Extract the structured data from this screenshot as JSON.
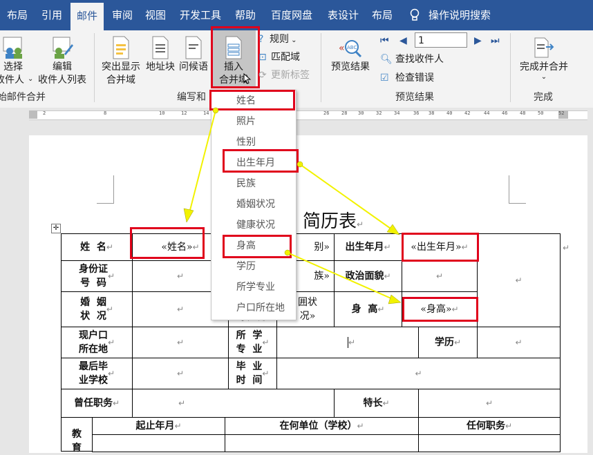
{
  "tabs": [
    "布局",
    "引用",
    "邮件",
    "审阅",
    "视图",
    "开发工具",
    "帮助",
    "百度网盘",
    "表设计",
    "布局"
  ],
  "tell_me": "操作说明搜索",
  "ribbon": {
    "select_recipients": [
      "选择",
      "收件人"
    ],
    "edit_recipients": [
      "编辑",
      "收件人列表"
    ],
    "start_group": "始邮件合并",
    "highlight": [
      "突出显示",
      "合并域"
    ],
    "address_block": "地址块",
    "greeting": "问候语",
    "insert_field": [
      "插入",
      "合并域"
    ],
    "rules": "规则",
    "match_fields": "匹配域",
    "update_labels": "更新标签",
    "write_group": "编写和",
    "preview_results": "预览结果",
    "record_number": "1",
    "find_recipient": "查找收件人",
    "check_errors": "检查错误",
    "preview_group": "预览结果",
    "finish_merge": "完成并合并",
    "finish_group": "完成"
  },
  "ruler_numbers": [
    "2",
    "8",
    "10",
    "12",
    "14",
    "26",
    "28",
    "30",
    "32",
    "34",
    "36",
    "38",
    "40",
    "42",
    "44",
    "46",
    "48",
    "50",
    "52"
  ],
  "dropdown_items": [
    "姓名",
    "照片",
    "性别",
    "出生年月",
    "民族",
    "婚姻状况",
    "健康状况",
    "身高",
    "学历",
    "所学专业",
    "户口所在地"
  ],
  "doc": {
    "title": "简历表",
    "cells": {
      "name_label": "姓  名",
      "name_field": "«姓名»",
      "gender_partial": "别»",
      "birth_label": "出生年月",
      "birth_field": "«出生年月»",
      "id_label": "身份证\n号  码",
      "ethnic_partial": "族»",
      "politics_label": "政治面貌",
      "marriage_label": "婚  姻\n状  况",
      "health_partial": "囲状\n况»",
      "health_label": "状  况",
      "height_label": "身  高",
      "height_field": "«身高»",
      "hukou_label": "现户口\n所在地",
      "major_label": "所  学\n专  业",
      "edu_label": "学历",
      "school_label": "最后毕\n业学校",
      "grad_label": "毕  业\n时  间",
      "former_label": "曾任职务",
      "special_label": "特长",
      "period_label": "起止年月",
      "unit_label": "在何单位（学校）",
      "position_label": "任何职务",
      "edu_side": "教\n育"
    },
    "return_mark": "↵"
  },
  "colors": {
    "accent": "#2b579a",
    "highlight_box": "#e0001b",
    "arrow": "#f2f200"
  }
}
